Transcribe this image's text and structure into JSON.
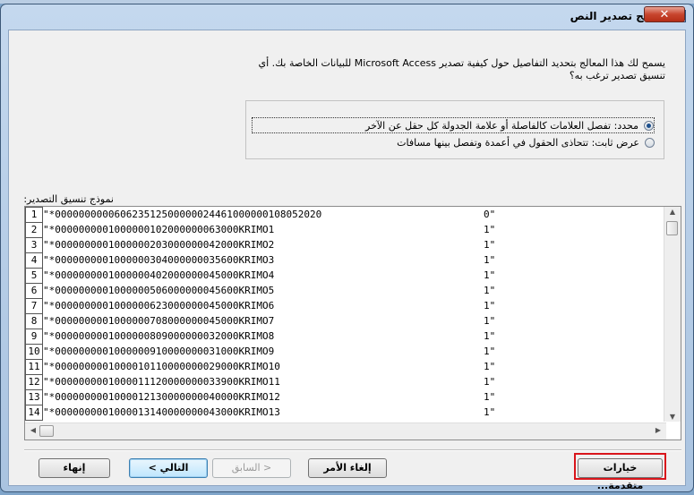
{
  "window": {
    "title": "معالج تصدير النص",
    "close_label": "✕"
  },
  "intro": {
    "line1": "يسمح لك هذا المعالج بتحديد التفاصيل حول كيفية تصدير Microsoft Access للبيانات الخاصة بك. أي",
    "line2": "تنسيق تصدير ترغب به؟"
  },
  "format_options": {
    "delimited": {
      "label": "محدد: تفصل العلامات كالفاصلة أو علامة الجدولة كل حقل عن الآخر",
      "selected": true
    },
    "fixed_width": {
      "label": "عرض ثابت: تتحاذى الحقول في أعمدة وتفصل بينها مسافات",
      "selected": false
    }
  },
  "sample": {
    "label": "نموذج تنسيق التصدير:",
    "rows": [
      {
        "num": "1",
        "text": "\"*0000000000606235125000000244610000001080520​20",
        "tail": "0\""
      },
      {
        "num": "2",
        "text": "\"*000000000100000010200000006300​0KRIMO1",
        "tail": "1\""
      },
      {
        "num": "3",
        "text": "\"*000000000100000020300000004200​0KRIMO2",
        "tail": "1\""
      },
      {
        "num": "4",
        "text": "\"*000000000100000030400000003560​0KRIMO3",
        "tail": "1\""
      },
      {
        "num": "5",
        "text": "\"*000000000100000040200000004500​0KRIMO4",
        "tail": "1\""
      },
      {
        "num": "6",
        "text": "\"*000000000100000050600000004560​0KRIMO5",
        "tail": "1\""
      },
      {
        "num": "7",
        "text": "\"*000000000100000062300000004500​0KRIMO6",
        "tail": "1\""
      },
      {
        "num": "8",
        "text": "\"*000000000100000070800000004500​0KRIMO7",
        "tail": "1\""
      },
      {
        "num": "9",
        "text": "\"*000000000100000080900000003200​0KRIMO8",
        "tail": "1\""
      },
      {
        "num": "10",
        "text": "\"*000000000100000091000000003100​0KRIMO9",
        "tail": "1\""
      },
      {
        "num": "11",
        "text": "\"*000000000100001011000000002900​0KRIMO10",
        "tail": "1\""
      },
      {
        "num": "12",
        "text": "\"*000000000100001112000000003390​0KRIMO11",
        "tail": "1\""
      },
      {
        "num": "13",
        "text": "\"*000000000100001213000000004000​0KRIMO12",
        "tail": "1\""
      },
      {
        "num": "14",
        "text": "\"*000000000100001314000000004300​0KRIMO13",
        "tail": "1\""
      }
    ]
  },
  "buttons": {
    "advanced": "خيارات متقدمة...",
    "cancel": "إلغاء الأمر",
    "back": "< السابق",
    "next": "التالي >",
    "finish": "إنهاء"
  }
}
